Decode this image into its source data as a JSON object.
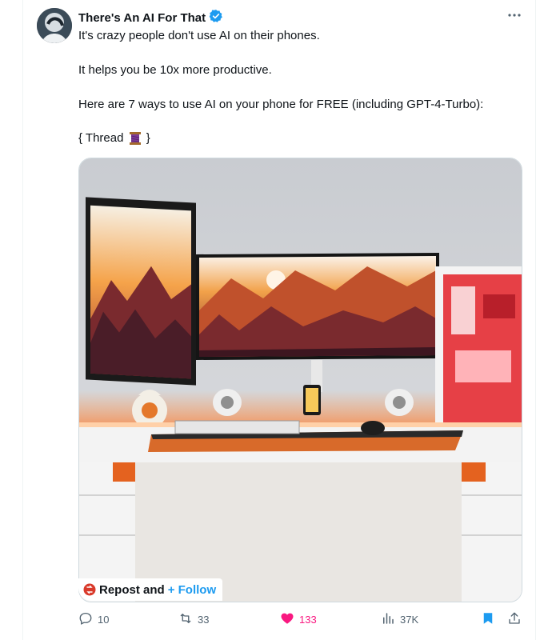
{
  "author": {
    "name": "There's An AI For That",
    "verified": true
  },
  "menu_icon": "more-icon",
  "tweet": {
    "line1": "It's crazy people don't use AI on their phones.",
    "line2": "It helps you be 10x more productive.",
    "line3": "Here are 7 ways to use AI on your phone for FREE (including GPT-4-Turbo):",
    "line4_before": "{ Thread ",
    "line4_after": " }"
  },
  "media_overlay": {
    "repost_label": "Repost and",
    "follow_label": "+ Follow"
  },
  "actions": {
    "replies": "10",
    "reposts": "33",
    "likes": "133",
    "views": "37K"
  },
  "colors": {
    "text": "#0f1419",
    "muted": "#536471",
    "link": "#1d9bf0",
    "like": "#f91880",
    "verified": "#1d9bf0"
  }
}
